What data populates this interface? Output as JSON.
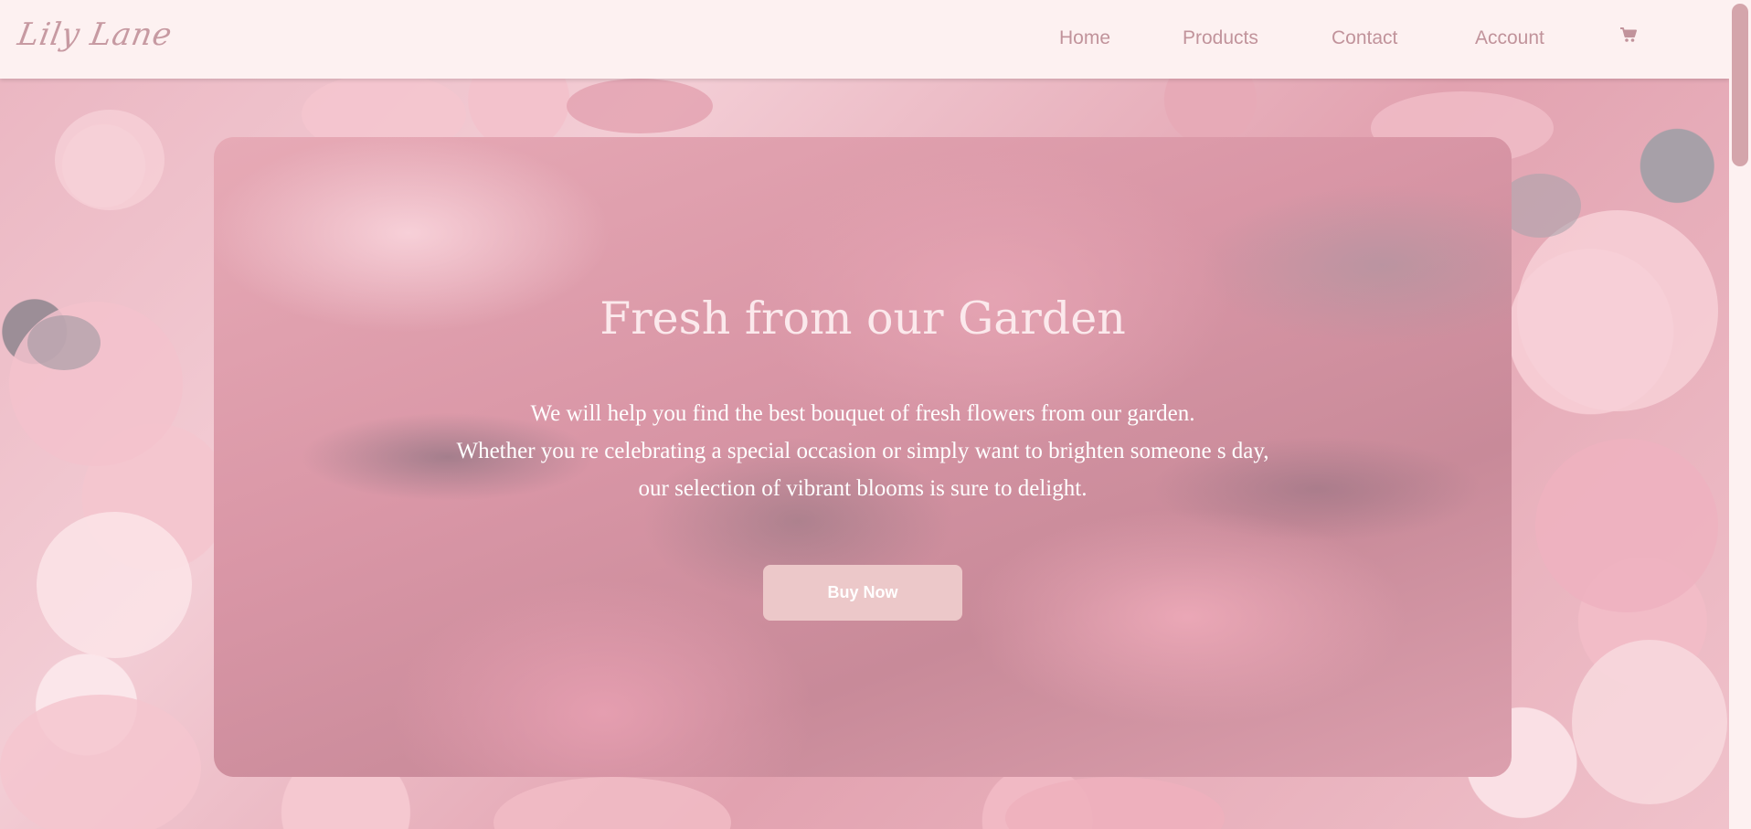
{
  "header": {
    "logo_text": "Lily Lane",
    "nav": [
      {
        "label": "Home"
      },
      {
        "label": "Products"
      },
      {
        "label": "Contact"
      },
      {
        "label": "Account"
      }
    ],
    "cart_icon": "shopping-cart-icon"
  },
  "hero": {
    "title": "Fresh from our Garden",
    "lines": [
      "We will help you find the best bouquet of fresh flowers from our garden.",
      "Whether you re celebrating a special occasion or simply want to brighten someone s day,",
      "our selection of vibrant blooms is sure to delight."
    ],
    "button_label": "Buy Now"
  },
  "colors": {
    "header_bg": "#fdf1f1",
    "nav_text": "#c1939b",
    "button_bg": "#ecc8c9",
    "scroll_thumb": "#d4a5ab"
  }
}
